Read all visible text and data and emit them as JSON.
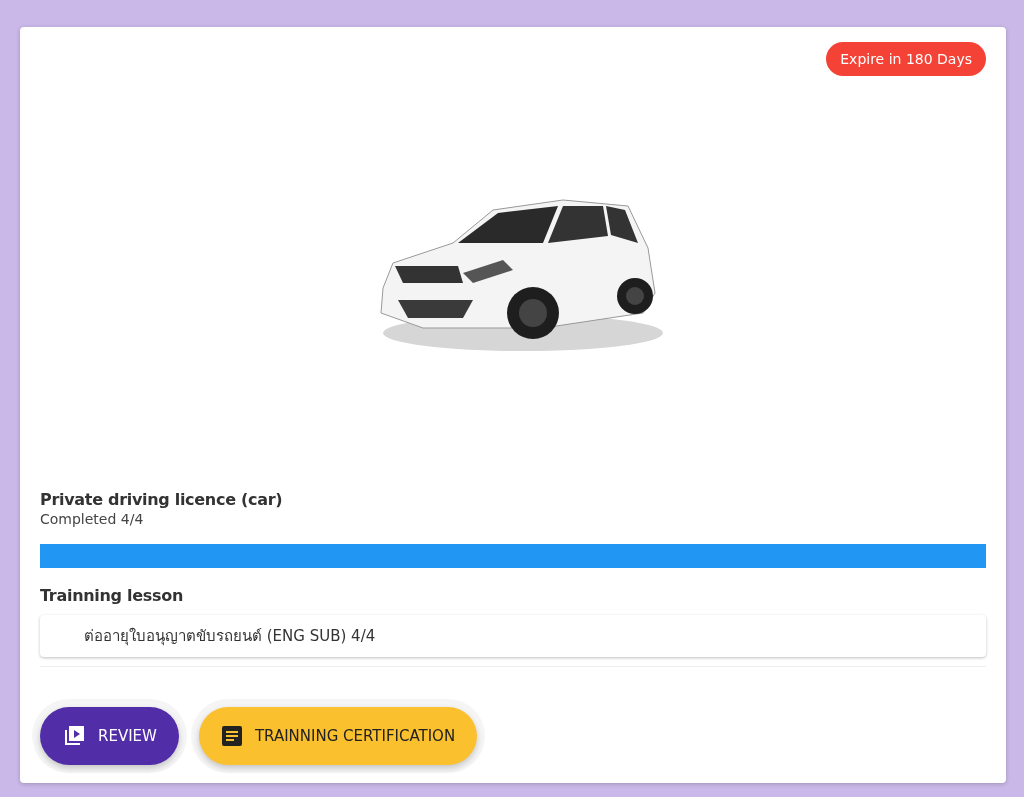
{
  "badge": {
    "label": "Expire in 180 Days"
  },
  "course": {
    "title": "Private driving licence (car)",
    "status": "Completed 4/4",
    "progress": {
      "level": 1
    }
  },
  "lessons": {
    "heading": "Trainning lesson",
    "items": [
      {
        "label": "ต่ออายุใบอนุญาตขับรถยนต์ (ENG SUB) 4/4"
      }
    ]
  },
  "buttons": [
    {
      "kind": "review",
      "label": "REVIEW"
    },
    {
      "kind": "certificate",
      "label": "TRAINNING CERTIFICATION"
    }
  ]
}
